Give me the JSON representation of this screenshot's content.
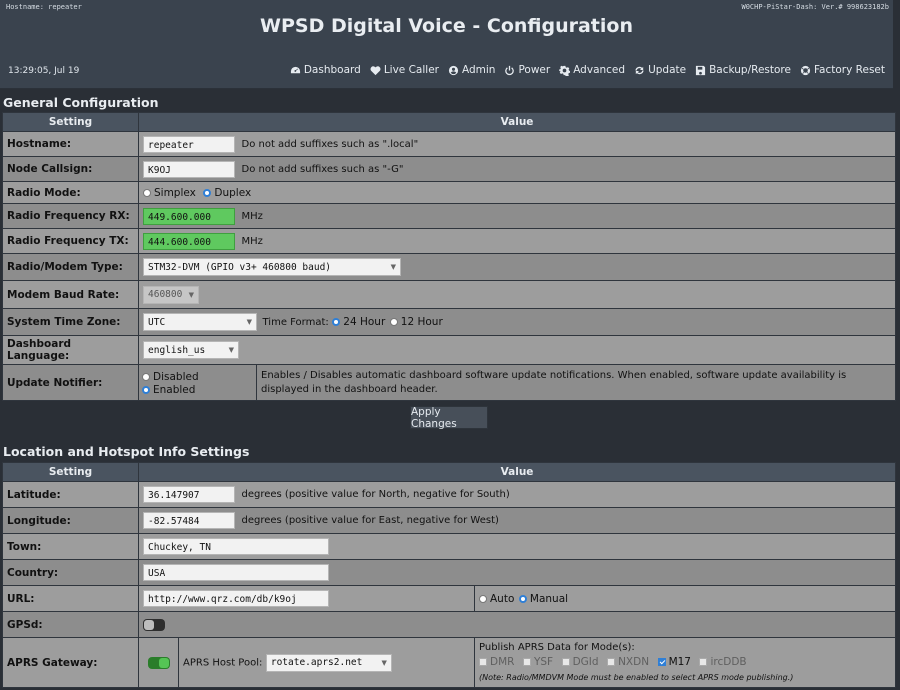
{
  "header": {
    "hostname_line": "Hostname: repeater",
    "version_line": "W0CHP-PiStar-Dash: Ver.# 998623182b",
    "title": "WPSD Digital Voice - Configuration",
    "time": "13:29:05, Jul 19",
    "nav": [
      {
        "label": "Dashboard",
        "icon": "dashboard-icon"
      },
      {
        "label": "Live Caller",
        "icon": "heart-pulse-icon"
      },
      {
        "label": "Admin",
        "icon": "user-circle-icon"
      },
      {
        "label": "Power",
        "icon": "power-icon"
      },
      {
        "label": "Advanced",
        "icon": "gear-icon"
      },
      {
        "label": "Update",
        "icon": "refresh-icon"
      },
      {
        "label": "Backup/Restore",
        "icon": "floppy-icon"
      },
      {
        "label": "Factory Reset",
        "icon": "lifebuoy-icon"
      }
    ]
  },
  "general": {
    "title": "General Configuration",
    "col_setting": "Setting",
    "col_value": "Value",
    "hostname": {
      "label": "Hostname:",
      "value": "repeater",
      "hint": "Do not add suffixes such as \".local\""
    },
    "callsign": {
      "label": "Node Callsign:",
      "value": "K9OJ",
      "hint": "Do not add suffixes such as \"-G\""
    },
    "radio_mode": {
      "label": "Radio Mode:",
      "opt1": "Simplex",
      "opt2": "Duplex",
      "selected": "Duplex"
    },
    "freq_rx": {
      "label": "Radio Frequency RX:",
      "value": "449.600.000",
      "unit": "MHz"
    },
    "freq_tx": {
      "label": "Radio Frequency TX:",
      "value": "444.600.000",
      "unit": "MHz"
    },
    "modem": {
      "label": "Radio/Modem Type:",
      "value": "STM32-DVM (GPIO v3+ 460800 baud)"
    },
    "baud": {
      "label": "Modem Baud Rate:",
      "value": "460800"
    },
    "timezone": {
      "label": "System Time Zone:",
      "value": "UTC",
      "format_label": "Time Format:",
      "opt1": "24 Hour",
      "opt2": "12 Hour",
      "selected": "24 Hour"
    },
    "language": {
      "label": "Dashboard Language:",
      "value": "english_us"
    },
    "notifier": {
      "label": "Update Notifier:",
      "opt1": "Disabled",
      "opt2": "Enabled",
      "selected": "Enabled",
      "desc": "Enables / Disables automatic dashboard software update notifications. When enabled, software update availability is displayed in the dashboard header."
    },
    "apply_label": "Apply Changes"
  },
  "location": {
    "title": "Location and Hotspot Info Settings",
    "col_setting": "Setting",
    "col_value": "Value",
    "latitude": {
      "label": "Latitude:",
      "value": "36.147907",
      "hint": "degrees (positive value for North, negative for South)"
    },
    "longitude": {
      "label": "Longitude:",
      "value": "-82.57484",
      "hint": "degrees (positive value for East, negative for West)"
    },
    "town": {
      "label": "Town:",
      "value": "Chuckey, TN"
    },
    "country": {
      "label": "Country:",
      "value": "USA"
    },
    "url": {
      "label": "URL:",
      "value": "http://www.qrz.com/db/k9oj",
      "opt1": "Auto",
      "opt2": "Manual",
      "selected": "Manual"
    },
    "gpsd": {
      "label": "GPSd:",
      "enabled": false
    },
    "aprs": {
      "label": "APRS Gateway:",
      "enabled": true,
      "pool_label": "APRS Host Pool:",
      "pool_value": "rotate.aprs2.net",
      "publish_label": "Publish APRS Data for Mode(s):",
      "modes": [
        {
          "name": "DMR",
          "checked": false
        },
        {
          "name": "YSF",
          "checked": false
        },
        {
          "name": "DGId",
          "checked": false
        },
        {
          "name": "NXDN",
          "checked": false
        },
        {
          "name": "M17",
          "checked": true
        },
        {
          "name": "ircDDB",
          "checked": false
        }
      ],
      "note": "(Note: Radio/MMDVM Mode must be enabled to select APRS mode publishing.)"
    }
  }
}
